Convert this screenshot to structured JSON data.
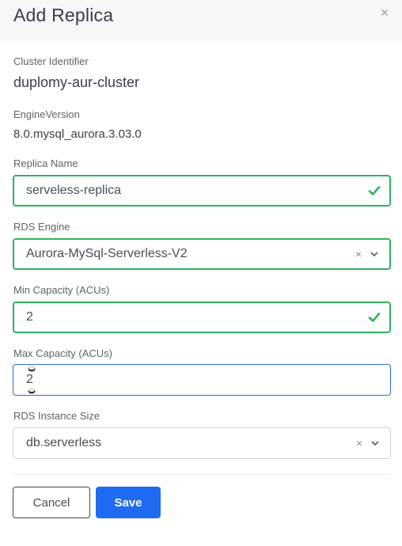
{
  "modal": {
    "title": "Add Replica",
    "close_glyph": "×"
  },
  "cluster": {
    "label": "Cluster Identifier",
    "value": "duplomy-aur-cluster"
  },
  "engine_version": {
    "label": "EngineVersion",
    "value": "8.0.mysql_aurora.3.03.0"
  },
  "replica_name": {
    "label": "Replica Name",
    "value": "serveless-replica",
    "status": "valid"
  },
  "rds_engine": {
    "label": "RDS Engine",
    "selected": "Aurora-MySql-Serverless-V2",
    "clear_glyph": "×"
  },
  "min_capacity": {
    "label": "Min Capacity (ACUs)",
    "value": "2",
    "status": "valid"
  },
  "max_capacity": {
    "label": "Max Capacity (ACUs)",
    "value": "2",
    "status": "focused"
  },
  "instance_size": {
    "label": "RDS Instance Size",
    "selected": "db.serverless",
    "clear_glyph": "×"
  },
  "actions": {
    "cancel_label": "Cancel",
    "save_label": "Save"
  },
  "colors": {
    "valid_border": "#2eb35f",
    "focus_border": "#2d6ad6",
    "primary_button": "#1f6bf2",
    "header_bg": "#f7f7f8"
  },
  "icons": {
    "close": "close-icon",
    "check": "check-icon",
    "clear": "clear-icon",
    "chevron": "chevron-down-icon",
    "spin": "spinner-arrows-icon"
  }
}
